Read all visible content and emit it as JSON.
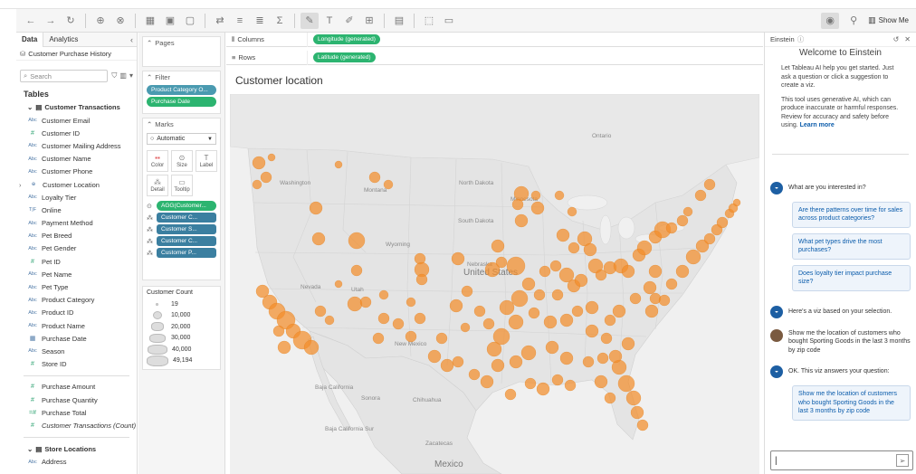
{
  "toolbar": {
    "show_me_label": "Show Me"
  },
  "data_pane": {
    "tabs": [
      "Data",
      "Analytics"
    ],
    "source_name": "Customer Purchase History",
    "search_placeholder": "Search",
    "tables_title": "Tables",
    "group1": "Customer Transactions",
    "fields1": [
      {
        "type": "Abc",
        "name": "Customer Email"
      },
      {
        "type": "#",
        "name": "Customer ID"
      },
      {
        "type": "Abc",
        "name": "Customer Mailing Address"
      },
      {
        "type": "Abc",
        "name": "Customer Name"
      },
      {
        "type": "Abc",
        "name": "Customer Phone"
      },
      {
        "type": "geo",
        "name": "Customer Location"
      },
      {
        "type": "Abc",
        "name": "Loyalty Tier"
      },
      {
        "type": "T|F",
        "name": "Online"
      },
      {
        "type": "Abc",
        "name": "Payment Method"
      },
      {
        "type": "Abc",
        "name": "Pet Breed"
      },
      {
        "type": "Abc",
        "name": "Pet Gender"
      },
      {
        "type": "#",
        "name": "Pet ID"
      },
      {
        "type": "Abc",
        "name": "Pet Name"
      },
      {
        "type": "Abc",
        "name": "Pet Type"
      },
      {
        "type": "Abc",
        "name": "Product Category"
      },
      {
        "type": "Abc",
        "name": "Product ID"
      },
      {
        "type": "Abc",
        "name": "Product Name"
      },
      {
        "type": "date",
        "name": "Purchase Date"
      },
      {
        "type": "Abc",
        "name": "Season"
      },
      {
        "type": "#",
        "name": "Store ID"
      }
    ],
    "measures1": [
      {
        "type": "#",
        "name": "Purchase Amount"
      },
      {
        "type": "#",
        "name": "Purchase Quantity"
      },
      {
        "type": "=#",
        "name": "Purchase Total"
      },
      {
        "type": "#",
        "name": "Customer Transactions (Count)"
      }
    ],
    "group2": "Store Locations",
    "fields2": [
      {
        "type": "Abc",
        "name": "Address"
      }
    ]
  },
  "shelves": {
    "pages_label": "Pages",
    "filter_label": "Filter",
    "filters": [
      "Product Category O...",
      "Purchase Date"
    ],
    "marks_label": "Marks",
    "mark_type": "Automatic",
    "mark_buttons": [
      "Color",
      "Size",
      "Label",
      "Detail",
      "Tooltip"
    ],
    "mark_pills": [
      "AGG(Customer...",
      "Customer C...",
      "Customer S...",
      "Customer C...",
      "Customer P..."
    ],
    "columns_label": "Columns",
    "columns_pill": "Longitude (generated)",
    "rows_label": "Rows",
    "rows_pill": "Latitude (generated)"
  },
  "legend": {
    "title": "Customer Count",
    "values": [
      "19",
      "10,000",
      "20,000",
      "30,000",
      "40,000",
      "49,194"
    ]
  },
  "view": {
    "title": "Customer location",
    "map_labels": {
      "ontario": "Ontario",
      "washington": "Washington",
      "montana": "Montana",
      "north_dakota": "North Dakota",
      "minnesota": "Minnesota",
      "south_dakota": "South Dakota",
      "wyoming": "Wyoming",
      "nebraska": "Nebraska",
      "nevada": "Nevada",
      "utah": "Utah",
      "united_states": "United States",
      "new_mexico": "New Mexico",
      "baja_california": "Baja California",
      "sonora": "Sonora",
      "chihuahua": "Chihuahua",
      "baja_california_sur": "Baja California Sur",
      "zacatecas": "Zacatecas",
      "mexico": "Mexico"
    }
  },
  "einstein": {
    "header": "Einstein",
    "welcome": "Welcome to Einstein",
    "intro": "Let Tableau AI help you get started. Just ask a question or click a suggestion to create a viz.",
    "disclaimer": "This tool uses generative AI, which can produce inaccurate or harmful responses. Review for accuracy and safety before using.",
    "learn_more": "Learn more",
    "prompt_q": "What are you interested in?",
    "suggestions": [
      "Are there patterns over time for sales across product categories?",
      "What pet types drive the most purchases?",
      "Does loyalty tier impact purchase size?"
    ],
    "viz_msg": "Here's a viz based on your selection.",
    "user_msg": "Show me the location of customers who bought Sporting Goods in the last 3 months by zip code",
    "answer_msg": "OK. This viz answers your question:",
    "answer_card": "Show me the location of customers who bought Sporting Goods in the last 3 months by zip code"
  },
  "colors": {
    "dot": "#f28e2b",
    "pill_green": "#2cb470",
    "pill_blue": "#4a9ab0",
    "link": "#0b5cab"
  }
}
